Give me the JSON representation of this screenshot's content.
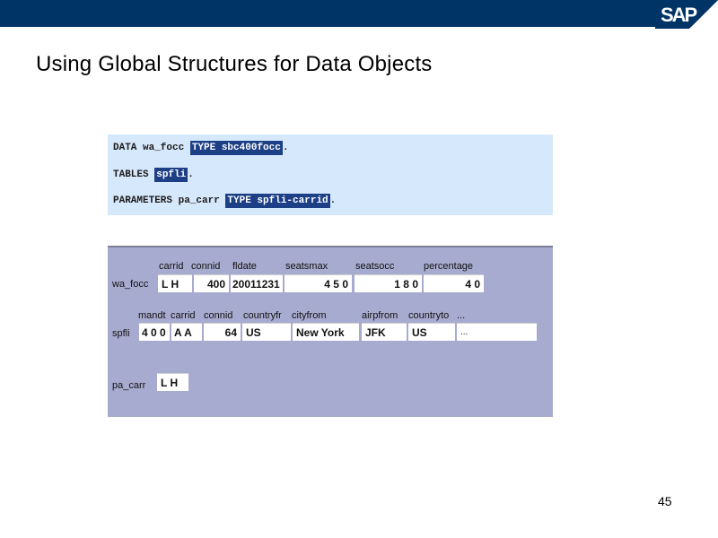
{
  "header": {
    "brand": "SAP",
    "bar_color": "#003366"
  },
  "title": "Using Global Structures for Data Objects",
  "code": {
    "lines": [
      {
        "prefix": "DATA wa_focc ",
        "highlight": "TYPE sbc400focc",
        "suffix": "."
      },
      {
        "prefix": "TABLES ",
        "highlight": "spfli",
        "suffix": "."
      },
      {
        "prefix": "PARAMETERS pa_carr ",
        "highlight": "TYPE spfli-carrid",
        "suffix": "."
      }
    ]
  },
  "panel": {
    "wa_focc": {
      "label": "wa_focc",
      "fields": [
        {
          "name": "carrid",
          "value": "L H"
        },
        {
          "name": "connid",
          "value": "400"
        },
        {
          "name": "fldate",
          "value": "20011231"
        },
        {
          "name": "seatsmax",
          "value": "4 5 0"
        },
        {
          "name": "seatsocc",
          "value": "1 8 0"
        },
        {
          "name": "percentage",
          "value": "4 0"
        }
      ]
    },
    "spfli": {
      "label": "spfli",
      "fields": [
        {
          "name": "mandt",
          "value": "4 0 0"
        },
        {
          "name": "carrid",
          "value": "A A"
        },
        {
          "name": "connid",
          "value": "64"
        },
        {
          "name": "countryfr",
          "value": "US"
        },
        {
          "name": "cityfrom",
          "value": "New York"
        },
        {
          "name": "airpfrom",
          "value": "JFK"
        },
        {
          "name": "countryto",
          "value": "US"
        },
        {
          "name": "more",
          "label": "...",
          "value": "..."
        }
      ]
    },
    "pa_carr": {
      "label": "pa_carr",
      "value": "L H"
    }
  },
  "page_number": "45"
}
